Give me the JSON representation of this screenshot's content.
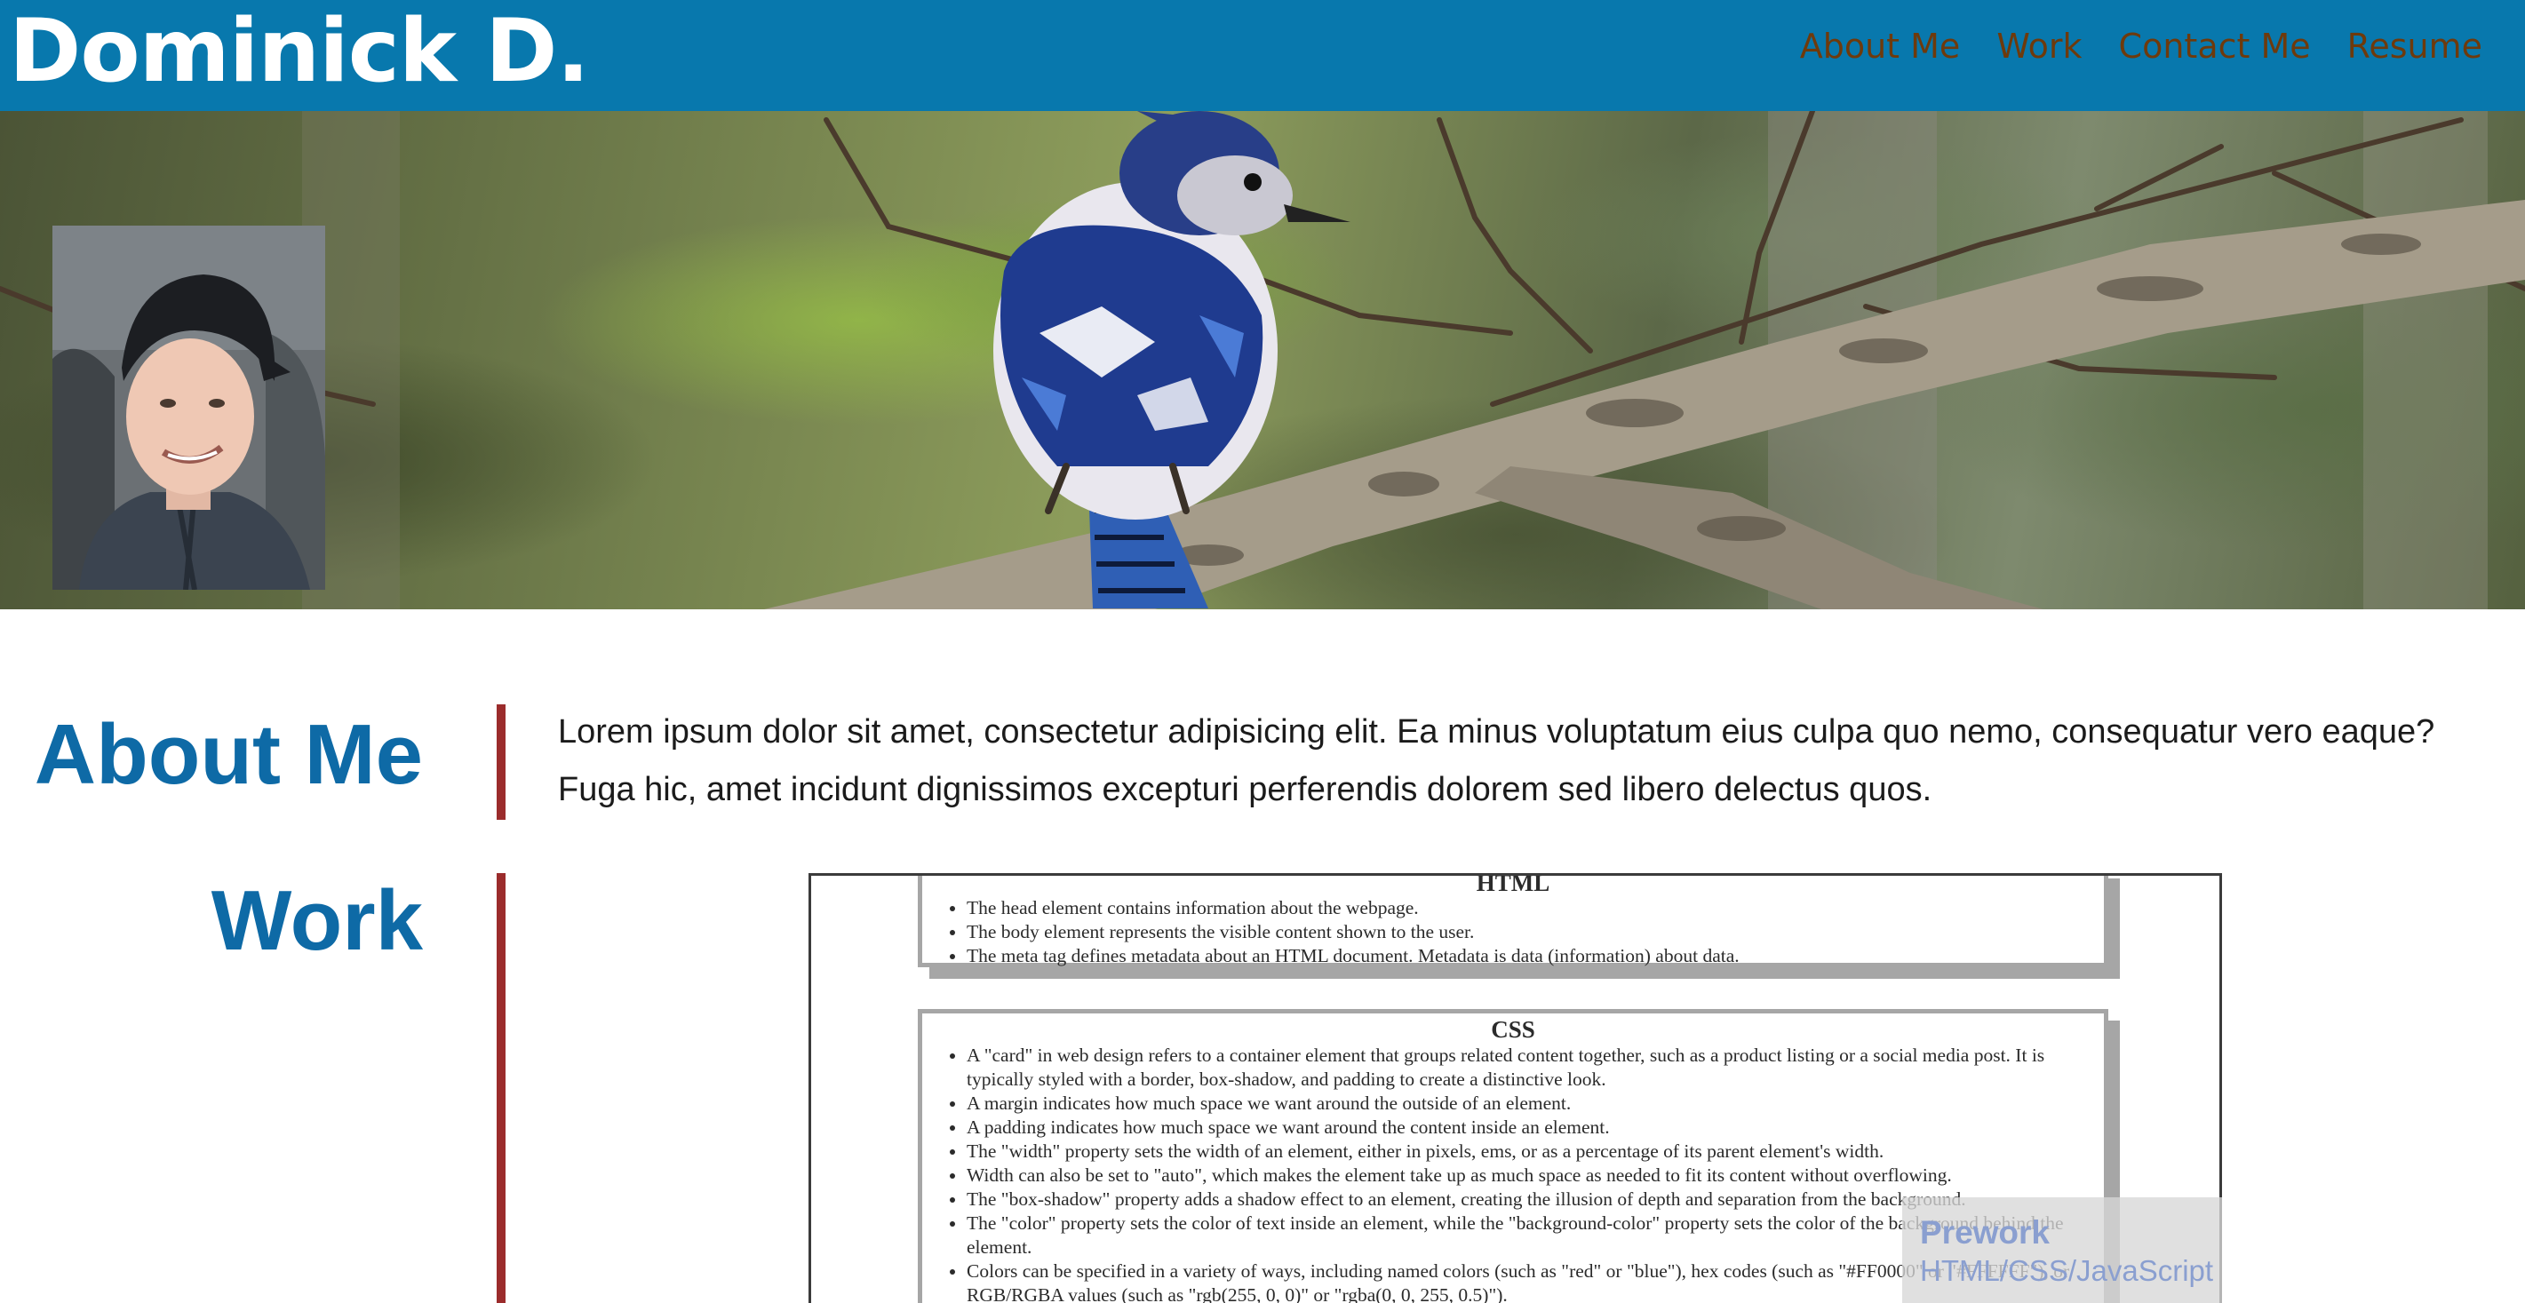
{
  "header": {
    "brand": "Dominick D.",
    "nav": [
      "About Me",
      "Work",
      "Contact Me",
      "Resume"
    ]
  },
  "hero": {
    "image": "blue-jay-on-branch",
    "portrait": "profile-photo"
  },
  "about": {
    "title": "About Me",
    "text": "Lorem ipsum dolor sit amet, consectetur adipisicing elit. Ea minus voluptatum eius culpa quo nemo, consequatur vero eaque? Fuga hic, amet incidunt dignissimos excepturi perferendis dolorem sed libero delectus quos."
  },
  "work": {
    "title": "Work",
    "preview": {
      "cards": [
        {
          "heading": "HTML",
          "items": [
            "The head element contains information about the webpage.",
            "The body element represents the visible content shown to the user.",
            "The meta tag defines metadata about an HTML document. Metadata is data (information) about data."
          ]
        },
        {
          "heading": "CSS",
          "items": [
            "A \"card\" in web design refers to a container element that groups related content together, such as a product listing or a social media post. It is typically styled with a border, box-shadow, and padding to create a distinctive look.",
            "A margin indicates how much space we want around the outside of an element.",
            "A padding indicates how much space we want around the content inside an element.",
            "The \"width\" property sets the width of an element, either in pixels, ems, or as a percentage of its parent element's width.",
            "Width can also be set to \"auto\", which makes the element take up as much space as needed to fit its content without overflowing.",
            "The \"box-shadow\" property adds a shadow effect to an element, creating the illusion of depth and separation from the background.",
            "The \"color\" property sets the color of text inside an element, while the \"background-color\" property sets the color of the background behind the element.",
            "Colors can be specified in a variety of ways, including named colors (such as \"red\" or \"blue\"), hex codes (such as \"#FF0000\" or \"#FFFFFF\"), or RGB/RGBA values (such as \"rgb(255, 0, 0)\" or \"rgba(0, 0, 255, 0.5)\")."
          ]
        }
      ],
      "overlay": {
        "title": "Prework",
        "subtitle": "HTML/CSS/JavaScript"
      }
    }
  },
  "colors": {
    "header_bg": "#0878ad",
    "nav_link": "#6e3a0c",
    "section_title": "#0e6aa6",
    "accent_rule": "#9b2c2c"
  }
}
